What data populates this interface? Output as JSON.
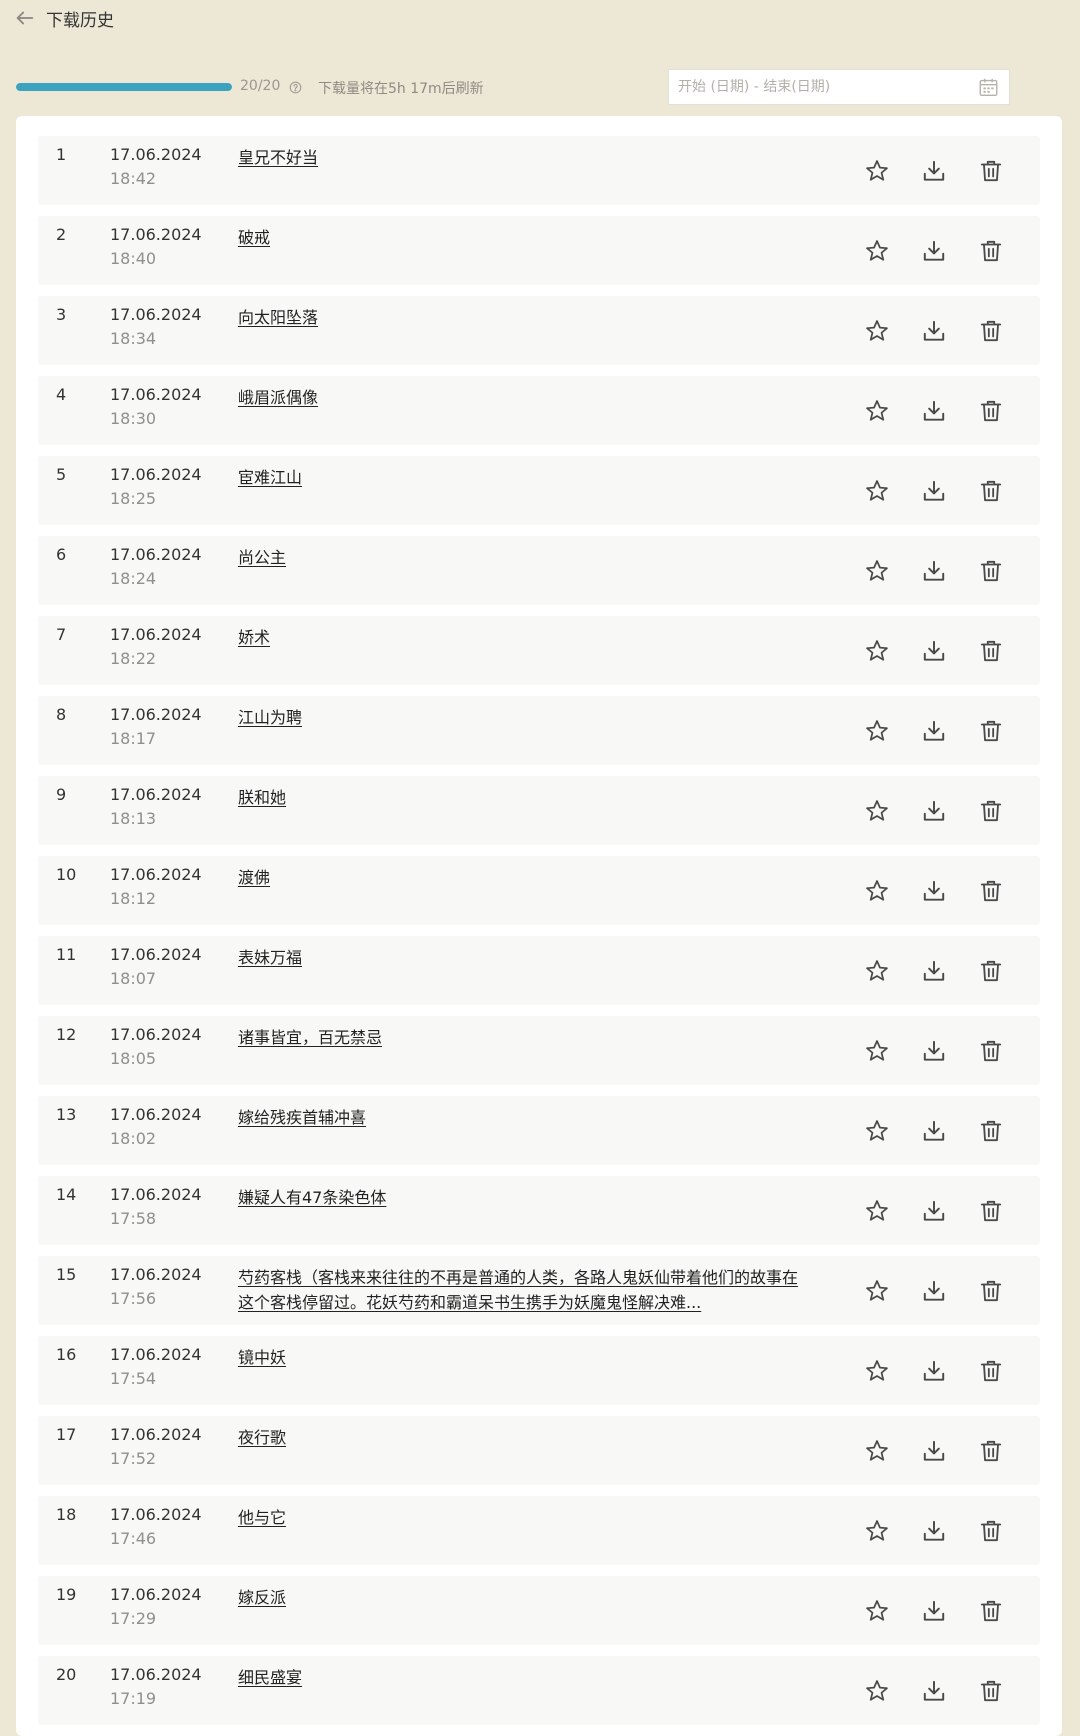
{
  "header": {
    "title": "下载历史",
    "back_icon": "arrow-left-icon"
  },
  "quota": {
    "progress_fraction": 1.0,
    "count_text": "20/20",
    "refresh_text": "下载量将在5h 17m后刷新",
    "accent_color": "#3ba3bf"
  },
  "date_filter": {
    "placeholder": "开始 (日期) - 结束(日期)",
    "value": ""
  },
  "icons": {
    "star": "star-icon",
    "download": "download-icon",
    "delete": "trash-icon",
    "calendar": "calendar-icon",
    "help": "help-circle-icon"
  },
  "downloads": [
    {
      "index": "1",
      "date": "17.06.2024",
      "time": "18:42",
      "title": "皇兄不好当"
    },
    {
      "index": "2",
      "date": "17.06.2024",
      "time": "18:40",
      "title": "破戒"
    },
    {
      "index": "3",
      "date": "17.06.2024",
      "time": "18:34",
      "title": "向太阳坠落"
    },
    {
      "index": "4",
      "date": "17.06.2024",
      "time": "18:30",
      "title": "峨眉派偶像"
    },
    {
      "index": "5",
      "date": "17.06.2024",
      "time": "18:25",
      "title": "宦难江山"
    },
    {
      "index": "6",
      "date": "17.06.2024",
      "time": "18:24",
      "title": "尚公主"
    },
    {
      "index": "7",
      "date": "17.06.2024",
      "time": "18:22",
      "title": "娇术"
    },
    {
      "index": "8",
      "date": "17.06.2024",
      "time": "18:17",
      "title": "江山为聘"
    },
    {
      "index": "9",
      "date": "17.06.2024",
      "time": "18:13",
      "title": "朕和她"
    },
    {
      "index": "10",
      "date": "17.06.2024",
      "time": "18:12",
      "title": "渡佛"
    },
    {
      "index": "11",
      "date": "17.06.2024",
      "time": "18:07",
      "title": "表妹万福"
    },
    {
      "index": "12",
      "date": "17.06.2024",
      "time": "18:05",
      "title": "诸事皆宜，百无禁忌"
    },
    {
      "index": "13",
      "date": "17.06.2024",
      "time": "18:02",
      "title": "嫁给残疾首辅冲喜"
    },
    {
      "index": "14",
      "date": "17.06.2024",
      "time": "17:58",
      "title": "嫌疑人有47条染色体"
    },
    {
      "index": "15",
      "date": "17.06.2024",
      "time": "17:56",
      "title": "芍药客栈（客栈来来往往的不再是普通的人类，各路人鬼妖仙带着他们的故事在这个客栈停留过。花妖芍药和霸道呆书生携手为妖魔鬼怪解决难..."
    },
    {
      "index": "16",
      "date": "17.06.2024",
      "time": "17:54",
      "title": "镜中妖"
    },
    {
      "index": "17",
      "date": "17.06.2024",
      "time": "17:52",
      "title": "夜行歌"
    },
    {
      "index": "18",
      "date": "17.06.2024",
      "time": "17:46",
      "title": "他与它"
    },
    {
      "index": "19",
      "date": "17.06.2024",
      "time": "17:29",
      "title": "嫁反派"
    },
    {
      "index": "20",
      "date": "17.06.2024",
      "time": "17:19",
      "title": "细民盛宴"
    }
  ]
}
